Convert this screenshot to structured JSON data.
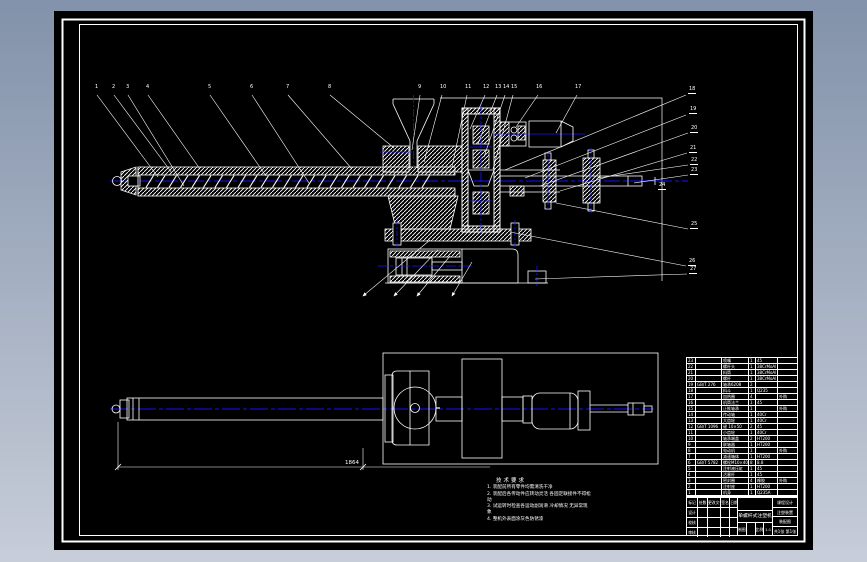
{
  "colors": {
    "model_space_bg": "#000000",
    "line": "#ffffff",
    "centerline": "#1414ff",
    "window_frame": "#8c9ab0"
  },
  "drawing": {
    "balloons_top": [
      "1",
      "2",
      "3",
      "4",
      "5",
      "6",
      "7",
      "8",
      "9",
      "10",
      "11",
      "12",
      "13",
      "14",
      "15",
      "16",
      "17"
    ],
    "balloons_right": [
      "18",
      "19",
      "20",
      "21",
      "22",
      "23",
      "24",
      "25",
      "26",
      "27"
    ],
    "dimension_bottom": "1864",
    "tech_requirements": {
      "title": "技术要求",
      "lines": [
        "1. 装配前所有零件均需清洗干净",
        "2. 装配后各传动件应转动灵活 各固定联接件不得松",
        "动",
        "3. 试运转时检查各运动副润滑 冷却情况  无异常现",
        "象",
        "4. 整机外表面涂灰色防锈漆"
      ]
    }
  },
  "bom": {
    "headers": [
      "序号",
      "代号",
      "名称",
      "数量",
      "材料",
      "备注"
    ],
    "rows": [
      [
        "23",
        "",
        "喷嘴",
        "1",
        "45",
        ""
      ],
      [
        "22",
        "",
        "螺杆头",
        "1",
        "38CrMoAl",
        ""
      ],
      [
        "21",
        "",
        "料筒",
        "1",
        "38CrMoAl",
        ""
      ],
      [
        "20",
        "",
        "螺杆",
        "1",
        "38CrMoAl",
        ""
      ],
      [
        "19",
        "GB/T 276",
        "轴承6208",
        "2",
        "",
        ""
      ],
      [
        "18",
        "",
        "料斗",
        "1",
        "Q235",
        ""
      ],
      [
        "17",
        "",
        "加热圈",
        "4",
        "",
        "外购"
      ],
      [
        "16",
        "",
        "机筒法兰",
        "1",
        "45",
        ""
      ],
      [
        "15",
        "",
        "止推轴承",
        "1",
        "",
        "外购"
      ],
      [
        "14",
        "",
        "传动轴",
        "1",
        "40Cr",
        ""
      ],
      [
        "13",
        "",
        "大齿轮",
        "1",
        "40Cr",
        ""
      ],
      [
        "12",
        "GB/T 1096",
        "键 10×50",
        "2",
        "45",
        ""
      ],
      [
        "11",
        "",
        "小齿轮",
        "1",
        "40Cr",
        ""
      ],
      [
        "10",
        "",
        "轴承端盖",
        "2",
        "HT200",
        ""
      ],
      [
        "9",
        "",
        "联轴器",
        "1",
        "HT200",
        ""
      ],
      [
        "8",
        "",
        "电动机",
        "1",
        "",
        "外购"
      ],
      [
        "7",
        "",
        "减速箱体",
        "1",
        "HT200",
        ""
      ],
      [
        "6",
        "GB/T 5782",
        "螺栓M10×40",
        "8",
        "8.8",
        ""
      ],
      [
        "5",
        "",
        "注射液压缸",
        "1",
        "45",
        ""
      ],
      [
        "4",
        "",
        "活塞杆",
        "1",
        "45",
        ""
      ],
      [
        "3",
        "",
        "密封圈",
        "4",
        "橡胶",
        "外购"
      ],
      [
        "2",
        "",
        "注射座",
        "1",
        "HT200",
        ""
      ],
      [
        "1",
        "",
        "机身",
        "1",
        "Q235A",
        ""
      ]
    ]
  },
  "title_block": {
    "left_rows": [
      [
        "标记",
        "处数",
        "更改文件号",
        "签名",
        "日期"
      ],
      [
        "设计",
        "",
        "",
        "",
        ""
      ],
      [
        "校核",
        "",
        "",
        "",
        ""
      ],
      [
        "审核",
        "",
        "",
        "",
        ""
      ]
    ],
    "title": "单螺杆式注塑机",
    "bottom_cells": [
      "制图",
      "",
      "比例",
      "1:1"
    ],
    "right_rows": [
      "课程设计",
      "注塑装置",
      "装配图",
      "共1张 第1张"
    ]
  }
}
